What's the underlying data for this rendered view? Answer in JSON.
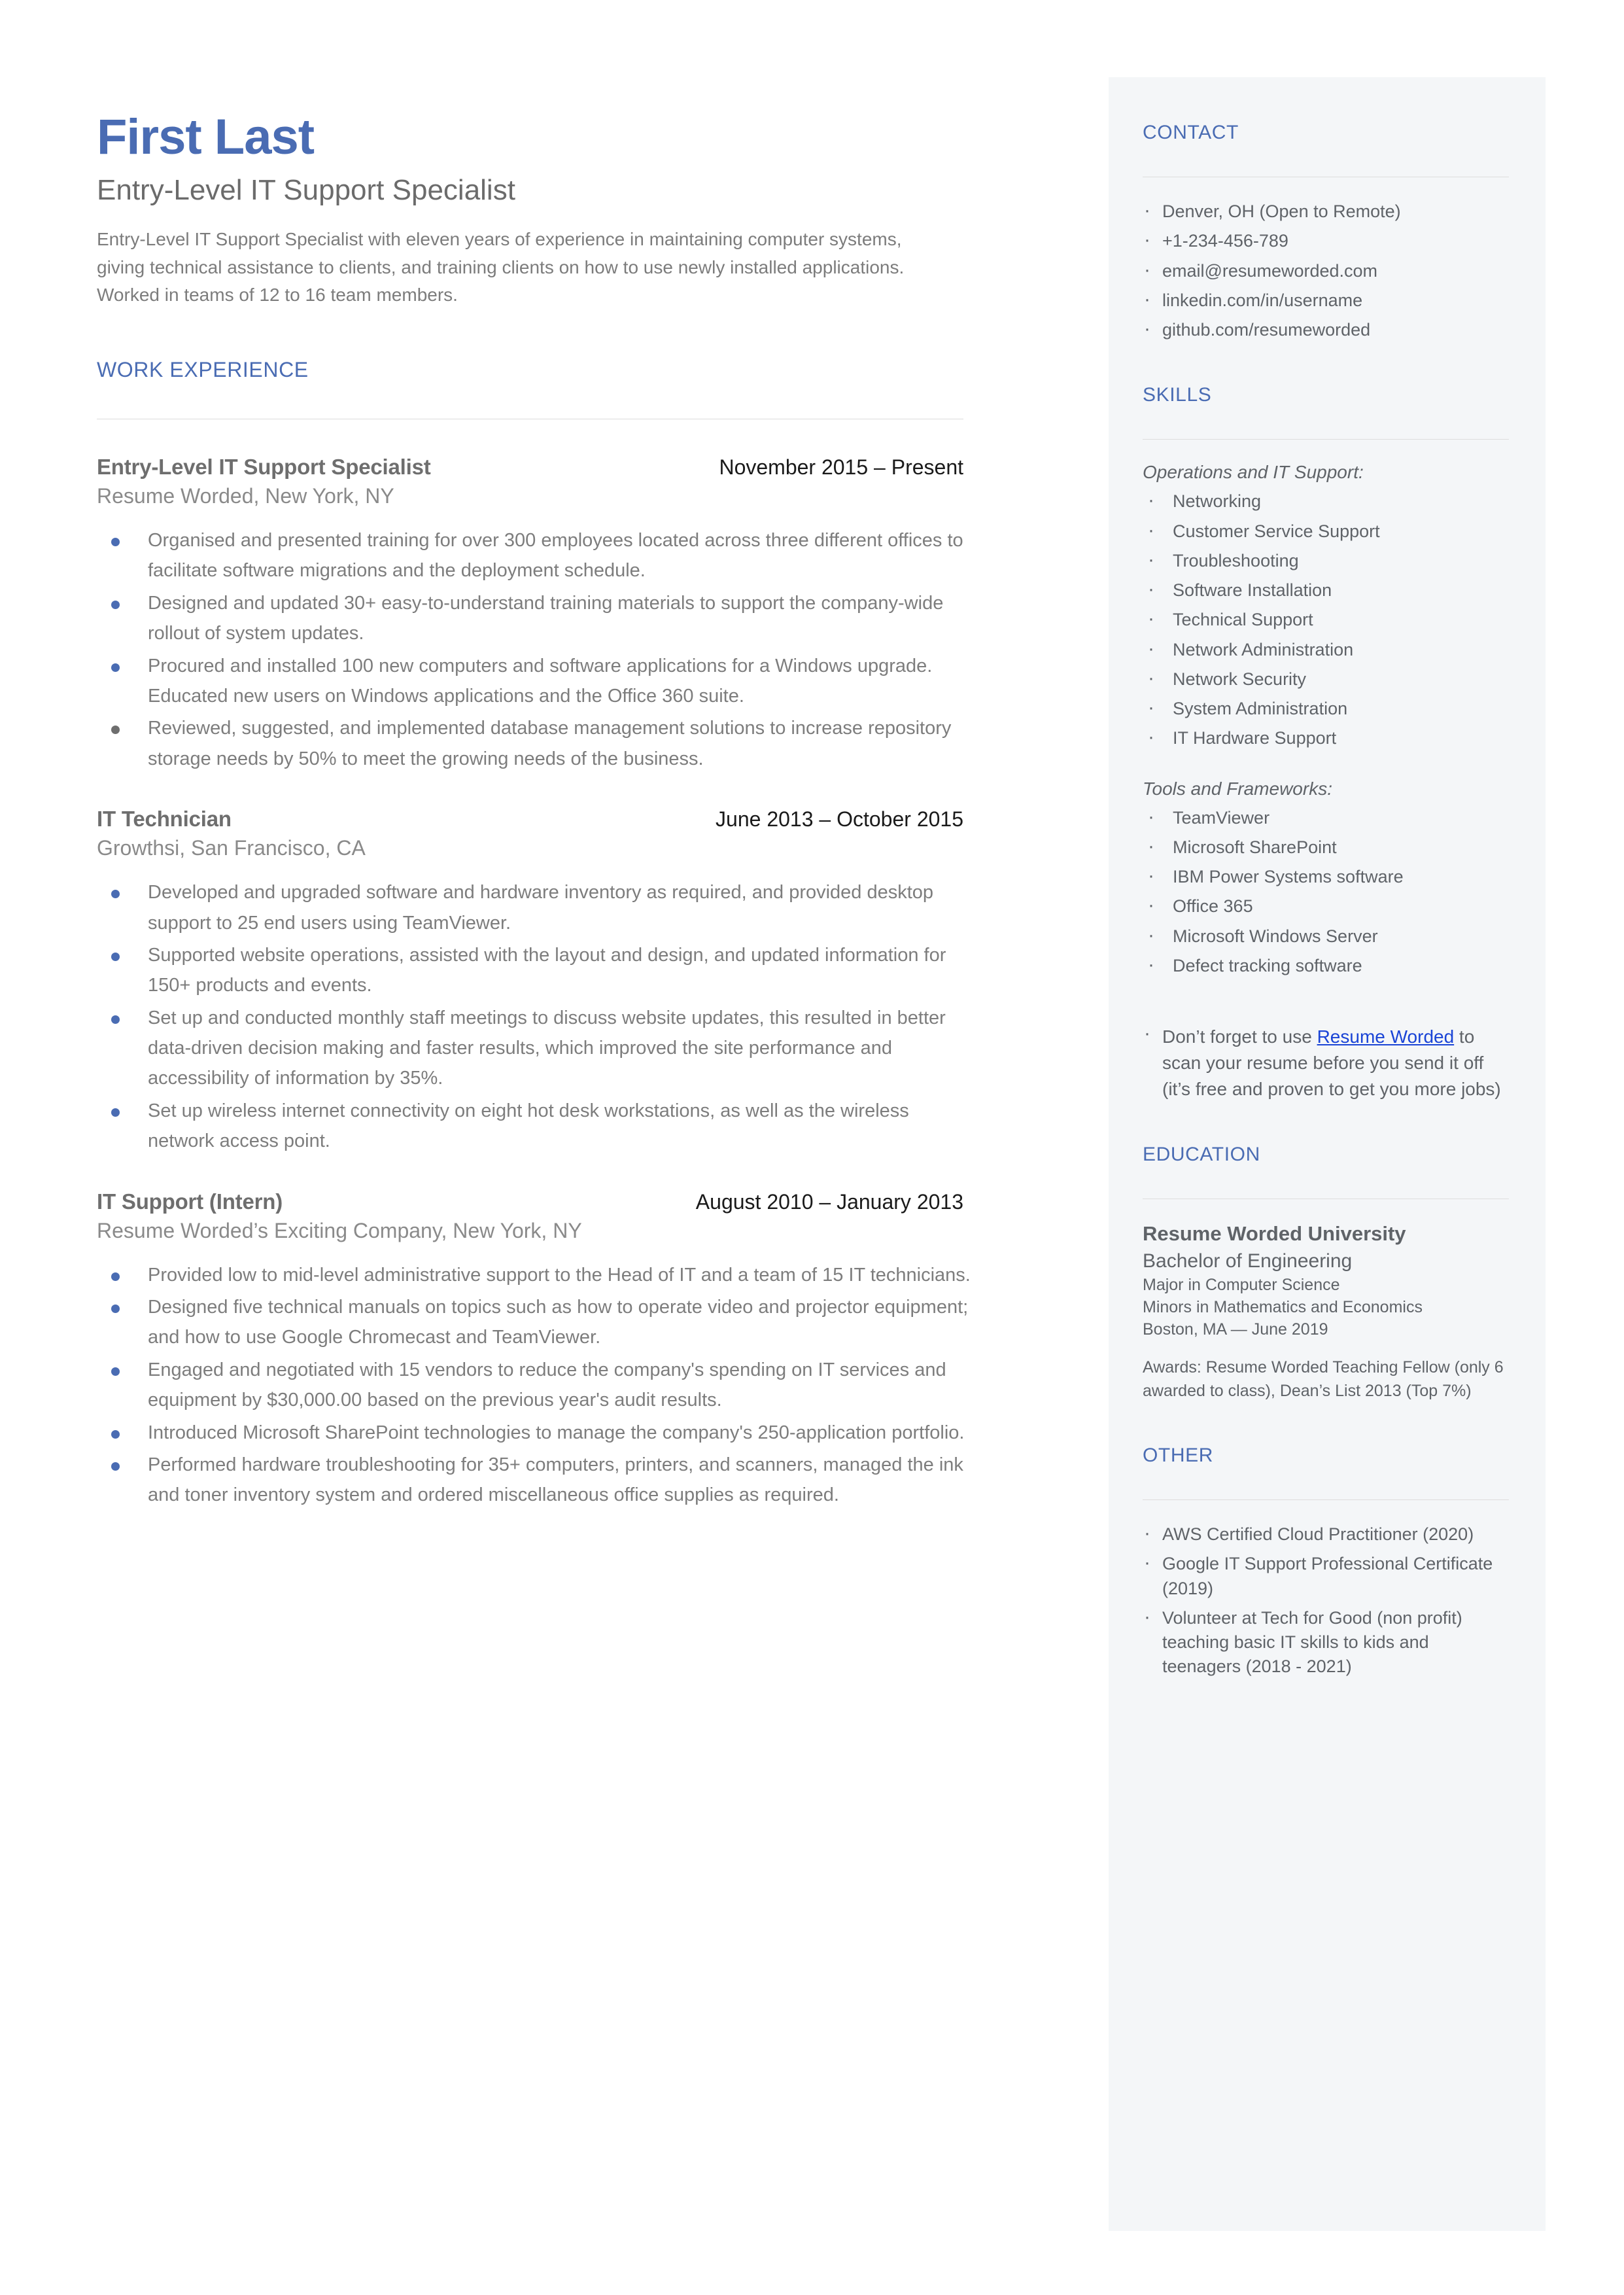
{
  "colors": {
    "accent_blue": "#4a6cb3",
    "link_blue": "#1a44d6",
    "body_gray": "#7d7d7d",
    "sidebar_bg": "#f4f6f8"
  },
  "header": {
    "name": "First Last",
    "headline": "Entry-Level IT Support Specialist",
    "summary": "Entry-Level IT Support Specialist with eleven years of experience in maintaining computer systems, giving technical assistance to clients, and training clients on how to use newly installed applications. Worked in teams of 12 to 16 team members."
  },
  "work": {
    "section_title": "WORK EXPERIENCE",
    "jobs": [
      {
        "title": "Entry-Level IT Support Specialist",
        "dates": "November 2015 – Present",
        "company": "Resume Worded, New York, NY",
        "bullets": [
          "Organised and presented training for over 300 employees located across three different offices to facilitate software migrations and the deployment schedule.",
          "Designed and updated 30+ easy-to-understand training materials to support the company-wide rollout of system updates.",
          "Procured and installed 100 new computers and software applications for a Windows upgrade. Educated new users on Windows applications and the Office 360 suite.",
          "Reviewed, suggested, and implemented database management solutions to increase repository storage needs by 50% to meet the growing needs of the business."
        ]
      },
      {
        "title": "IT Technician",
        "dates": "June 2013 – October 2015",
        "company": "Growthsi, San Francisco, CA",
        "bullets": [
          "Developed and upgraded software and hardware inventory as required, and provided desktop support to 25 end users using TeamViewer.",
          "Supported website operations, assisted with the layout and design, and updated information for 150+ products and events.",
          "Set up and conducted monthly staff meetings to discuss website updates, this resulted in better data-driven decision making and faster results, which improved the site performance and accessibility of information by 35%.",
          "Set up wireless internet connectivity on eight hot desk workstations, as well as the wireless network access point."
        ]
      },
      {
        "title": "IT Support (Intern)",
        "dates": "August 2010 – January 2013",
        "company": "Resume Worded’s Exciting Company, New York, NY",
        "bullets": [
          "Provided low to mid-level administrative support to the Head of IT and a team of 15 IT technicians.",
          "Designed five technical manuals on topics such as how to operate video and projector equipment; and how to use Google Chromecast and TeamViewer.",
          "Engaged and negotiated with 15 vendors to reduce the company's spending on IT services and equipment by $30,000.00 based on the previous year's audit results.",
          "Introduced Microsoft SharePoint technologies to manage the company's 250-application portfolio.",
          "Performed hardware troubleshooting for 35+ computers, printers, and scanners, managed the ink and toner inventory system and ordered miscellaneous office supplies as required."
        ]
      }
    ]
  },
  "contact": {
    "section_title": "CONTACT",
    "items": [
      "Denver, OH (Open to Remote)",
      "+1-234-456-789",
      "email@resumeworded.com",
      "linkedin.com/in/username",
      "github.com/resumeworded"
    ]
  },
  "skills": {
    "section_title": "SKILLS",
    "groups": [
      {
        "title": "Operations and IT Support:",
        "items": [
          "Networking",
          "Customer Service Support",
          "Troubleshooting",
          "Software Installation",
          "Technical Support",
          "Network Administration",
          "Network Security",
          "System Administration",
          "IT Hardware Support"
        ]
      },
      {
        "title": "Tools and Frameworks:",
        "items": [
          "TeamViewer",
          "Microsoft SharePoint",
          "IBM Power Systems software",
          "Office 365",
          "Microsoft Windows Server",
          "Defect tracking software"
        ]
      }
    ],
    "promo": {
      "before": "Don’t forget to use ",
      "link": "Resume Worded",
      "after": " to scan your resume before you send it off (it’s free and proven to get you more jobs)"
    }
  },
  "education": {
    "section_title": "EDUCATION",
    "school": "Resume Worded University",
    "degree": "Bachelor of Engineering",
    "major": "Major in Computer Science",
    "minors": "Minors in Mathematics and Economics",
    "location_date": "Boston, MA — June 2019",
    "awards": "Awards: Resume Worded Teaching Fellow (only 6 awarded to class), Dean’s List 2013 (Top 7%)"
  },
  "other": {
    "section_title": "OTHER",
    "items": [
      "AWS Certified Cloud Practitioner (2020)",
      "Google IT Support Professional Certificate (2019)",
      "Volunteer at Tech for Good (non profit) teaching basic IT skills to kids and teenagers (2018 - 2021)"
    ]
  }
}
